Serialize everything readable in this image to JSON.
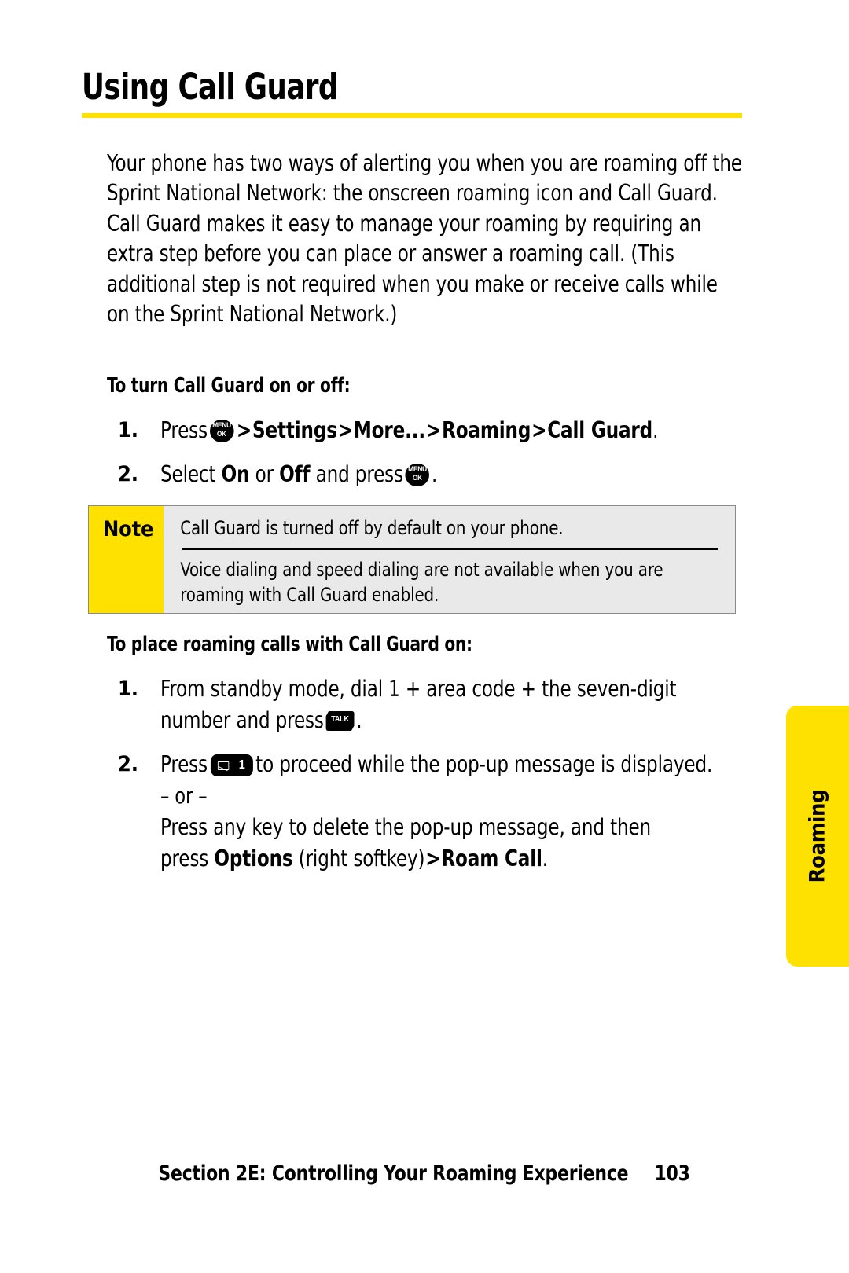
{
  "document": {
    "title": "Using Call Guard",
    "accent_yellow": "#FFE100",
    "note_bg": "#E9E9E9"
  },
  "intro": {
    "paragraph": "Your phone has two ways of alerting you when you are roaming off the Sprint National Network: the onscreen roaming icon and Call Guard. Call Guard makes it easy to manage your roaming by requiring an extra step before you can place or answer a roaming call. (This additional step is not required when you make or receive calls while on the Sprint National Network.)"
  },
  "procedure1": {
    "heading": "To turn Call Guard on or off:",
    "steps": [
      {
        "number": "1.",
        "pre": "Press",
        "key": {
          "line1": "MENU",
          "line2": "OK"
        },
        "parts": [
          {
            "text": ">",
            "bold": true
          },
          {
            "text": "Settings",
            "bold": true
          },
          {
            "text": ">",
            "bold": true
          },
          {
            "text": "More...",
            "bold": true
          },
          {
            "text": ">",
            "bold": true
          },
          {
            "text": "Roaming",
            "bold": true
          },
          {
            "text": ">",
            "bold": true
          },
          {
            "text": "Call Guard",
            "bold": true
          },
          {
            "text": ".",
            "bold": false
          }
        ]
      },
      {
        "number": "2.",
        "pre": "Select",
        "on_label": "On",
        "mid": "or",
        "off_label": "Off",
        "post": "and press",
        "key": {
          "line1": "MENU",
          "line2": "OK"
        },
        "end": "."
      }
    ]
  },
  "note": {
    "label": "Note",
    "paragraph1": "Call Guard is turned off by default on your phone.",
    "paragraph2": "Voice dialing and speed dialing are not available when you are roaming with Call Guard enabled."
  },
  "procedure2": {
    "heading": "To place roaming calls with Call Guard on:",
    "steps": [
      {
        "number": "1.",
        "text_before": "From standby mode, dial 1 + area code + the seven-digit number and press",
        "key_label": "TALK",
        "text_after": "."
      },
      {
        "number": "2.",
        "pre": "Press",
        "key_digit": "1",
        "text_after": "to proceed while the pop-up message is displayed.",
        "or_separator": "– or –",
        "alt_text_before": "Press any key to delete the pop-up message, and then press",
        "alt_bold1": "Options",
        "alt_mid": "(right softkey)",
        "alt_gt": ">",
        "alt_bold2": "Roam Call",
        "alt_end": "."
      }
    ]
  },
  "side_tab": {
    "label": "Roaming"
  },
  "footer": {
    "section": "Section 2E: Controlling Your Roaming Experience",
    "page_number": "103"
  }
}
